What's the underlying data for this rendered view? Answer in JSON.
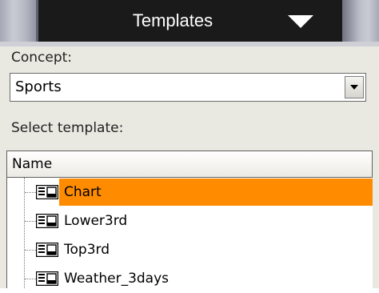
{
  "header": {
    "title": "Templates"
  },
  "concept": {
    "label": "Concept:",
    "selected": "Sports"
  },
  "select_template": {
    "label": "Select template:"
  },
  "list": {
    "column": "Name",
    "items": [
      {
        "label": "Chart",
        "selected": true
      },
      {
        "label": "Lower3rd",
        "selected": false
      },
      {
        "label": "Top3rd",
        "selected": false
      },
      {
        "label": "Weather_3days",
        "selected": false
      }
    ]
  },
  "colors": {
    "selection": "#ff8c00",
    "header_bg": "#1a1a1a",
    "panel_bg": "#e9e8e1"
  },
  "icons": {
    "template": "template-icon",
    "dropdown": "chevron-down-icon"
  }
}
